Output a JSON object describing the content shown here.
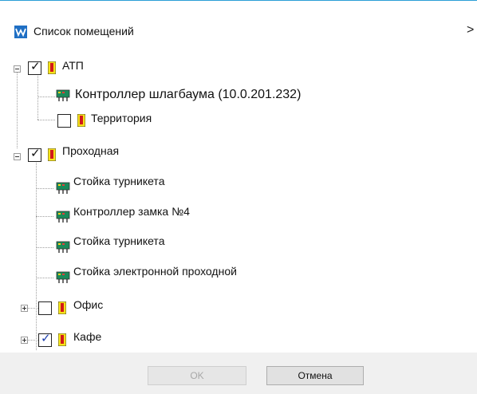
{
  "window": {
    "title": "Список помещений",
    "close_glyph": ">"
  },
  "tree": {
    "atp": {
      "label": "АТП",
      "checked": true
    },
    "controller_gate": {
      "label": "Контроллер шлагбаума (10.0.201.232)"
    },
    "territory": {
      "label": "Территория",
      "checked": false
    },
    "entrance": {
      "label": "Проходная",
      "checked": true
    },
    "turnstile1": {
      "label": "Стойка турникета"
    },
    "lock_controller": {
      "label": "Контроллер замка №4"
    },
    "turnstile2": {
      "label": "Стойка турникета"
    },
    "electronic_post": {
      "label": "Стойка электронной проходной"
    },
    "office": {
      "label": "Офис",
      "checked": false
    },
    "cafe": {
      "label": "Кафе",
      "checked": true
    }
  },
  "footer": {
    "ok_label": "OK",
    "cancel_label": "Отмена"
  },
  "colors": {
    "accent_line": "#2b9fd6",
    "check_blue": "#1c3fae",
    "room_yellow": "#f7e21a",
    "room_red": "#d11a1a"
  }
}
